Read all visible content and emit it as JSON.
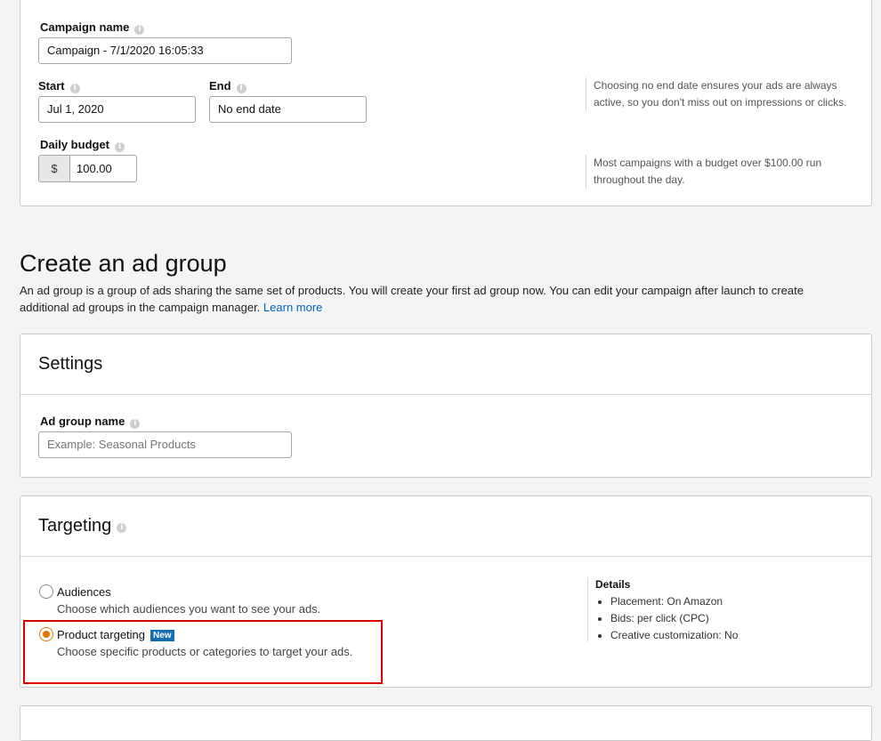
{
  "campaign": {
    "name_label": "Campaign name",
    "name_value": "Campaign - 7/1/2020 16:05:33",
    "start_label": "Start",
    "start_value": "Jul 1, 2020",
    "end_label": "End",
    "end_value": "No end date",
    "end_hint": "Choosing no end date ensures your ads are always active, so you don't miss out on impressions or clicks.",
    "budget_label": "Daily budget",
    "budget_currency": "$",
    "budget_value": "100.00",
    "budget_hint": "Most campaigns with a budget over $100.00 run throughout the day."
  },
  "ad_group": {
    "heading": "Create an ad group",
    "description": "An ad group is a group of ads sharing the same set of products. You will create your first ad group now. You can edit your campaign after launch to create additional ad groups in the campaign manager.",
    "learn_more": "Learn more"
  },
  "settings": {
    "title": "Settings",
    "name_label": "Ad group name",
    "name_placeholder": "Example: Seasonal Products"
  },
  "targeting": {
    "title": "Targeting",
    "options": [
      {
        "label": "Audiences",
        "description": "Choose which audiences you want to see your ads.",
        "selected": false
      },
      {
        "label": "Product targeting",
        "badge": "New",
        "description": "Choose specific products or categories to target your ads.",
        "selected": true
      }
    ],
    "details_title": "Details",
    "details": [
      "Placement: On Amazon",
      "Bids: per click (CPC)",
      "Creative customization: No"
    ]
  },
  "colors": {
    "accent": "#e77600",
    "link": "#0066c0",
    "badge": "#146eb4",
    "highlight_box": "#dd0000"
  },
  "icons": {
    "info": "info-icon"
  }
}
